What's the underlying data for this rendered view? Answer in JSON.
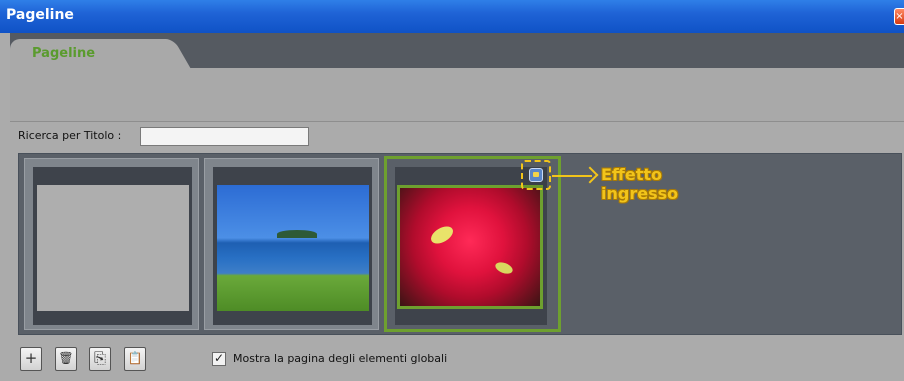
{
  "window": {
    "title": "Pageline",
    "close_icon": "×"
  },
  "tabs": [
    {
      "label": "Pageline",
      "active": true
    }
  ],
  "search": {
    "label": "Ricerca per Titolo :",
    "value": "",
    "placeholder": ""
  },
  "pages": [
    {
      "name": "blank-page",
      "thumbnail": "blank"
    },
    {
      "name": "landscape-page",
      "thumbnail": "lake-landscape"
    },
    {
      "name": "flower-page",
      "thumbnail": "red-flowers",
      "selected": true
    }
  ],
  "annotation": {
    "text_line1": "Effetto",
    "text_line2": "ingresso",
    "color": "#f2c41a"
  },
  "toolbar": {
    "add_icon": "+",
    "delete_icon": "🗑",
    "copy_icon": "⎘",
    "paste_icon": "📋"
  },
  "global_checkbox": {
    "label": "Mostra la pagina degli elementi globali",
    "checked": true,
    "check_glyph": "✓"
  },
  "colors": {
    "accent_green": "#6ea02f",
    "tab_label": "#5a9b2e",
    "titlebar": "#1f63d6"
  }
}
